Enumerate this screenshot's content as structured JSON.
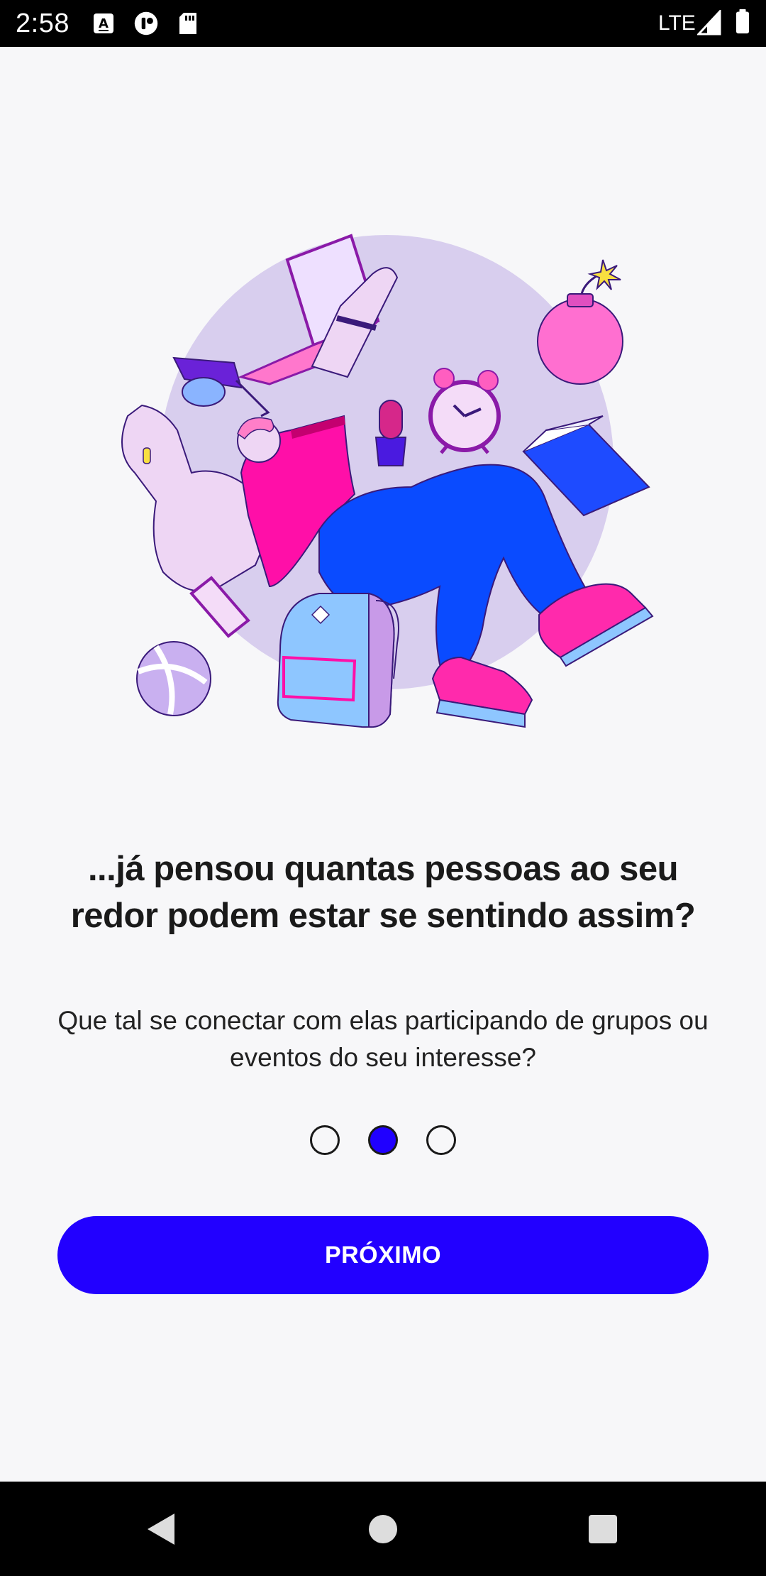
{
  "status_bar": {
    "time": "2:58",
    "network": "LTE",
    "icons": [
      "accessibility-a-icon",
      "app-logo-icon",
      "sd-card-icon",
      "signal-icon",
      "battery-icon"
    ]
  },
  "onboarding": {
    "illustration": "student-floating-with-school-items",
    "headline_line1": "...já pensou quantas pessoas ao seu",
    "headline_line2": "redor podem estar se sentindo assim?",
    "subtitle_line1": "Que tal se conectar com elas participando de grupos ou",
    "subtitle_line2": "eventos do seu interesse?",
    "page_indicator": {
      "total": 3,
      "current": 2
    },
    "next_label": "PRÓXIMO"
  },
  "nav_bar": {
    "buttons": [
      "back-icon",
      "home-icon",
      "recents-icon"
    ]
  },
  "colors": {
    "accent": "#2200ff",
    "background": "#f7f7f9",
    "text": "#1a1a1a",
    "pink": "#ff00a8",
    "blue": "#0a4bff",
    "lavender": "#d8ceee"
  }
}
